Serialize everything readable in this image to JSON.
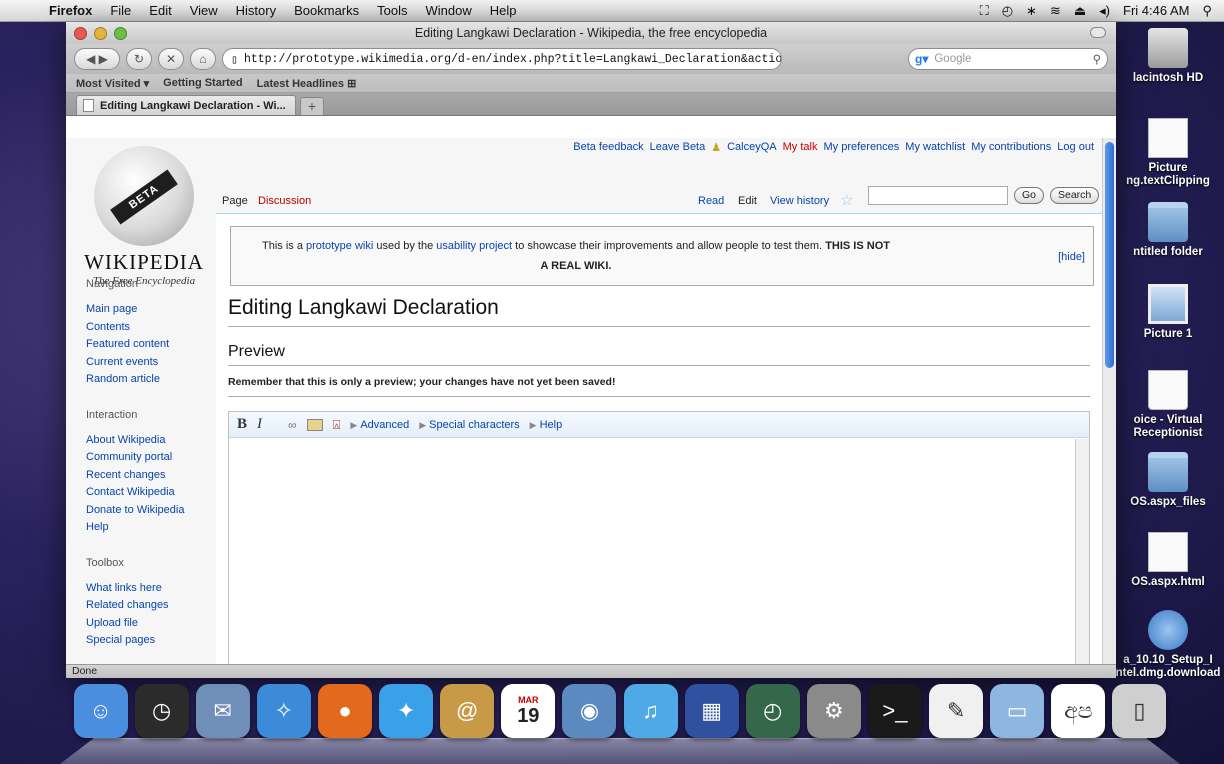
{
  "menubar": {
    "items": [
      "Firefox",
      "File",
      "Edit",
      "View",
      "History",
      "Bookmarks",
      "Tools",
      "Window",
      "Help"
    ],
    "clock": "Fri 4:46 AM"
  },
  "desktop": {
    "icons": [
      {
        "label": "lacintosh HD",
        "kind": "drive"
      },
      {
        "label": "Picture",
        "label2": "ng.textClipping",
        "kind": "doc"
      },
      {
        "label": "ntitled folder",
        "kind": "folder"
      },
      {
        "label": "Picture 1",
        "kind": "image"
      },
      {
        "label": "oice - Virtual",
        "label2": "Receptionist",
        "kind": "archive"
      },
      {
        "label": "OS.aspx_files",
        "kind": "folder"
      },
      {
        "label": "OS.aspx.html",
        "kind": "html"
      },
      {
        "label": "a_10.10_Setup_I",
        "label2": "ntel.dmg.download",
        "kind": "download"
      }
    ]
  },
  "window": {
    "title": "Editing Langkawi Declaration - Wikipedia, the free encyclopedia",
    "url": "http://prototype.wikimedia.org/d-en/index.php?title=Langkawi_Declaration&action=submit",
    "search_placeholder": "Google",
    "bookmarks": [
      "Most Visited ▾",
      "Getting Started",
      "Latest Headlines ⊞"
    ],
    "tab_title": "Editing Langkawi Declaration - Wi...",
    "status": "Done"
  },
  "wiki": {
    "logo_badge": "BETA",
    "wordmark": "WIKIPEDIA",
    "tagline": "The Free Encyclopedia",
    "personal": [
      "Beta feedback",
      "Leave Beta",
      "CalceyQA",
      "My talk",
      "My preferences",
      "My watchlist",
      "My contributions",
      "Log out"
    ],
    "ns_tabs": {
      "page": "Page",
      "discussion": "Discussion"
    },
    "view_tabs": {
      "read": "Read",
      "edit": "Edit",
      "history": "View history"
    },
    "buttons": {
      "go": "Go",
      "search": "Search"
    },
    "notice": {
      "pre": "This is a ",
      "link1": "prototype wiki",
      "mid1": " used by the ",
      "link2": "usability project",
      "mid2": " to showcase their improvements and allow people to test them. ",
      "strong1": "THIS IS NOT",
      "strong2": "A REAL WIKI.",
      "hide": "[hide]"
    },
    "heading": "Editing Langkawi Declaration",
    "preview_heading": "Preview",
    "preview_warning": "Remember that this is only a preview; your changes have not yet been saved!",
    "toolbar": {
      "bold": "B",
      "italic": "I",
      "advanced": "Advanced",
      "special": "Special characters",
      "help": "Help"
    },
    "sidebar": {
      "navigation": {
        "title": "Navigation",
        "links": [
          "Main page",
          "Contents",
          "Featured content",
          "Current events",
          "Random article"
        ]
      },
      "interaction": {
        "title": "Interaction",
        "links": [
          "About Wikipedia",
          "Community portal",
          "Recent changes",
          "Contact Wikipedia",
          "Donate to Wikipedia",
          "Help"
        ]
      },
      "toolbox": {
        "title": "Toolbox",
        "links": [
          "What links here",
          "Related changes",
          "Upload file",
          "Special pages"
        ]
      }
    }
  },
  "dock": {
    "apps": [
      {
        "name": "finder-icon",
        "color": "#4a8ee0",
        "glyph": "☺"
      },
      {
        "name": "dashboard-icon",
        "color": "#2b2b2b",
        "glyph": "◷"
      },
      {
        "name": "mail-icon",
        "color": "#6f8fb8",
        "glyph": "✉"
      },
      {
        "name": "safari-icon",
        "color": "#3b8bd9",
        "glyph": "✧"
      },
      {
        "name": "firefox-icon",
        "color": "#e36a1c",
        "glyph": "●"
      },
      {
        "name": "network-icon",
        "color": "#3aa0e8",
        "glyph": "✦"
      },
      {
        "name": "address-book-icon",
        "color": "#c89a48",
        "glyph": "@"
      },
      {
        "name": "ical-icon",
        "color": "#ffffff",
        "glyph": "19"
      },
      {
        "name": "iphoto-icon",
        "color": "#5a8ac0",
        "glyph": "◉"
      },
      {
        "name": "itunes-icon",
        "color": "#4ea9e6",
        "glyph": "♫"
      },
      {
        "name": "spaces-icon",
        "color": "#3050a0",
        "glyph": "▦"
      },
      {
        "name": "time-machine-icon",
        "color": "#35684a",
        "glyph": "◴"
      },
      {
        "name": "system-preferences-icon",
        "color": "#8a8a8a",
        "glyph": "⚙"
      },
      {
        "name": "terminal-icon",
        "color": "#1a1a1a",
        "glyph": ">_"
      },
      {
        "name": "textedit-icon",
        "color": "#f0f0f0",
        "glyph": "✎"
      },
      {
        "name": "downloads-folder-icon",
        "color": "#8fb6e0",
        "glyph": "▭"
      },
      {
        "name": "script-icon",
        "color": "#ffffff",
        "glyph": "අප"
      },
      {
        "name": "trash-icon",
        "color": "#cfcfcf",
        "glyph": "▯"
      }
    ],
    "ical_month": "MAR",
    "ical_day": "19"
  }
}
